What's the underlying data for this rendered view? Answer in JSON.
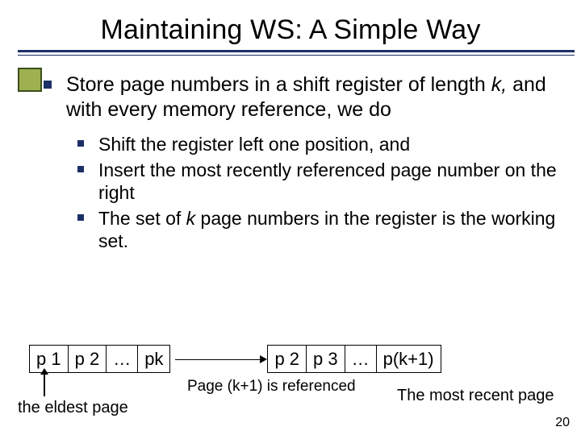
{
  "title": "Maintaining WS: A Simple Way",
  "bullet1_pre": "Store page numbers in a shift register of length ",
  "bullet1_k": "k,",
  "bullet1_post": " and with every memory reference, we do",
  "sub1": "Shift the register left one position, and",
  "sub2": "Insert the most recently referenced page number on the right",
  "sub3_pre": "The set of ",
  "sub3_k": "k",
  "sub3_post": " page numbers in the register is the working set.",
  "reg_before": [
    "p 1",
    "p 2",
    "…",
    "pk"
  ],
  "reg_after": [
    "p 2",
    "p 3",
    "…",
    "p(k+1)"
  ],
  "eldest_label": "the eldest page",
  "ref_caption": "Page (k+1) is referenced",
  "recent_label": "The most recent  page",
  "slide_number": "20"
}
